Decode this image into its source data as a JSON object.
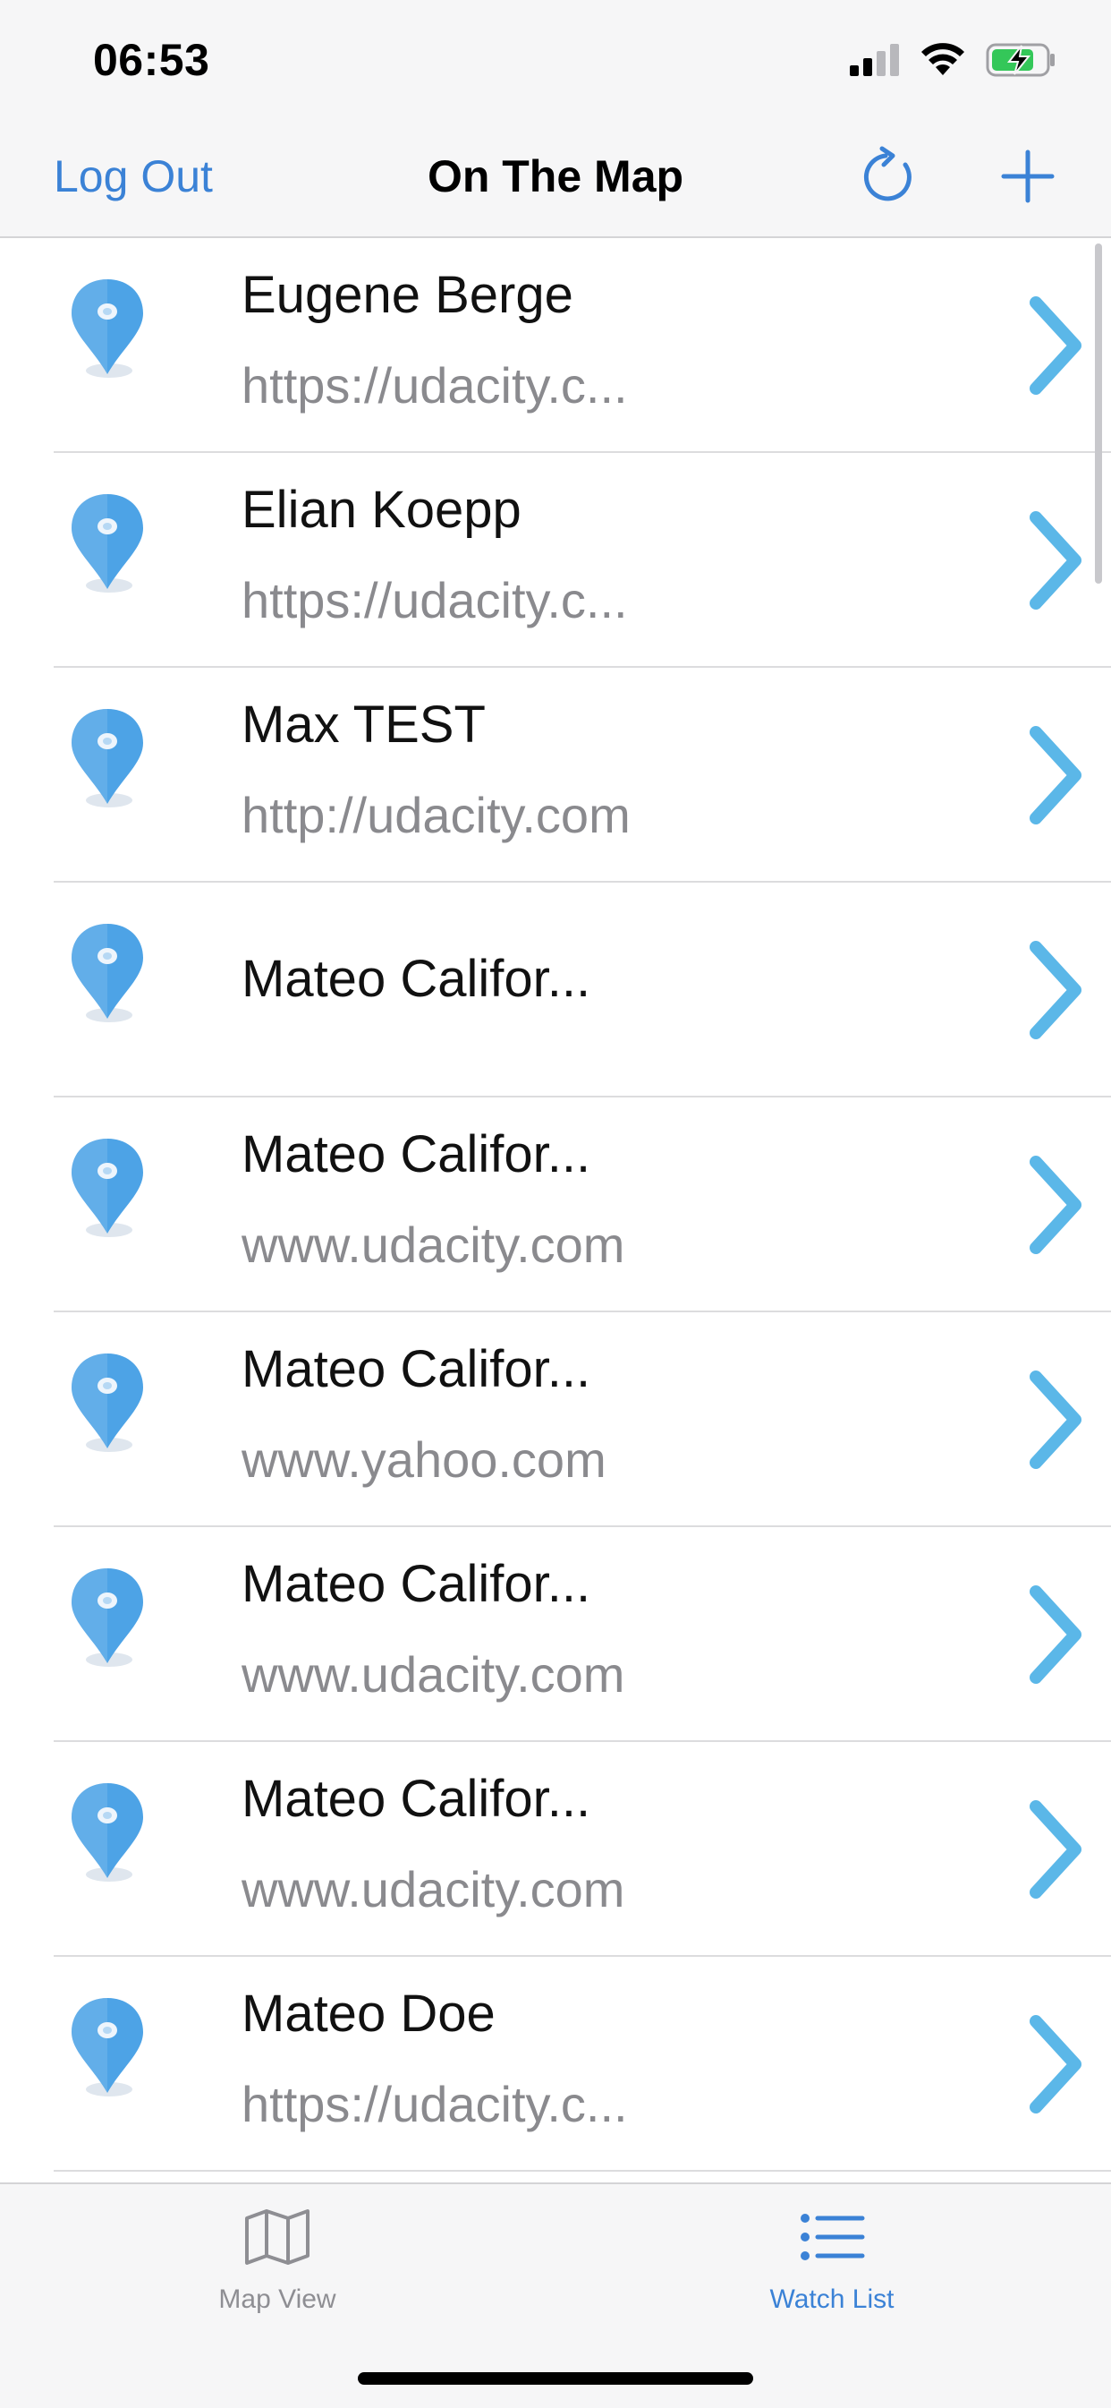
{
  "status_bar": {
    "time": "06:53",
    "icons": [
      "cellular-signal-icon",
      "wifi-icon",
      "battery-charging-icon"
    ]
  },
  "nav": {
    "left_button": "Log Out",
    "title": "On The Map",
    "right_icons": [
      "refresh-icon",
      "plus-icon"
    ],
    "accent_color": "#3b82d6"
  },
  "list": {
    "items": [
      {
        "title": "Eugene Berge",
        "subtitle": "https://udacity.c..."
      },
      {
        "title": "Elian Koepp",
        "subtitle": "https://udacity.c..."
      },
      {
        "title": "Max TEST",
        "subtitle": "http://udacity.com"
      },
      {
        "title": "Mateo Califor...",
        "subtitle": ""
      },
      {
        "title": "Mateo Califor...",
        "subtitle": "www.udacity.com"
      },
      {
        "title": "Mateo Califor...",
        "subtitle": "www.yahoo.com"
      },
      {
        "title": "Mateo Califor...",
        "subtitle": "www.udacity.com"
      },
      {
        "title": "Mateo Califor...",
        "subtitle": "www.udacity.com"
      },
      {
        "title": "Mateo Doe",
        "subtitle": "https://udacity.c..."
      }
    ],
    "pin_color": "#4da3e6",
    "chevron_color": "#5bb7e8"
  },
  "tab_bar": {
    "tabs": [
      {
        "label": "Map View",
        "icon": "map-icon",
        "selected": false
      },
      {
        "label": "Watch List",
        "icon": "list-icon",
        "selected": true
      }
    ]
  }
}
